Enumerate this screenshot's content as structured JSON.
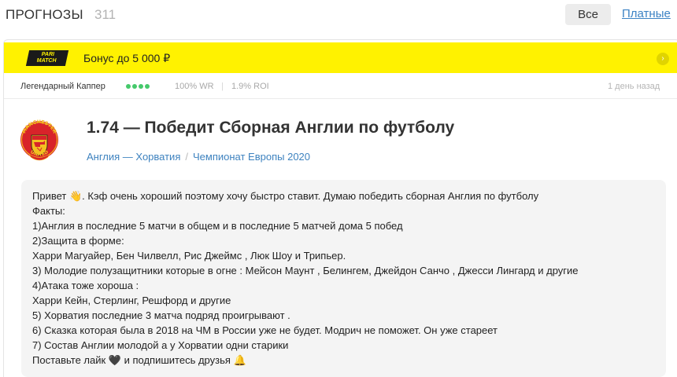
{
  "header": {
    "title": "ПРОГНОЗЫ",
    "count": "311",
    "filters": {
      "all": "Все",
      "paid": "Платные"
    }
  },
  "promo": {
    "brand_line1": "PARI",
    "brand_line2": "MATCH",
    "text": "Бонус до 5 000 ₽",
    "background": "#fff200"
  },
  "meta": {
    "tipster_rank": "Легендарный Каппер",
    "rating_dots": 4,
    "win_rate": "100% WR",
    "separator": "|",
    "roi": "1.9% ROI",
    "posted": "1 день назад",
    "accent": "#45c96b"
  },
  "bet": {
    "title": "1.74 — Победит Сборная Англии по футболу",
    "match": "Англия — Хорватия",
    "crumb_separator": "/",
    "tournament": "Чемпионат Европы 2020",
    "crest": {
      "icon": "manchester-united-crest-icon",
      "top_text": "MANCHESTER",
      "bottom_text": "UNITED"
    }
  },
  "comment": {
    "lines": [
      "Привет 👋. Кэф очень хороший поэтому хочу быстро ставит. Думаю победить сборная Англия по футболу",
      "Факты:",
      "1)Англия в последние 5 матчи в общем и в последние 5 матчей дома 5 побед",
      "2)Защита в форме:",
      "Харри Магуайер, Бен Чилвелл, Рис Джеймс , Люк Шоу и Трипьер.",
      "3) Молодие полузащитники которые в огне : Мейсон Маунт , Белингем, Джейдон Санчо , Джесси Лингард и другие",
      "4)Атака тоже хороша :",
      "Харри Кейн, Стерлинг, Решфорд и другие",
      "5) Хорватия последние 3 матча подряд проигрывают .",
      "6) Сказка которая была в 2018 на ЧМ в России уже не будет. Модрич не поможет. Он уже стареет",
      "7) Состав Англии молодой а у Хорватии одни старики",
      "Поставьте лайк 🖤 и подпишитесь друзья 🔔"
    ]
  }
}
